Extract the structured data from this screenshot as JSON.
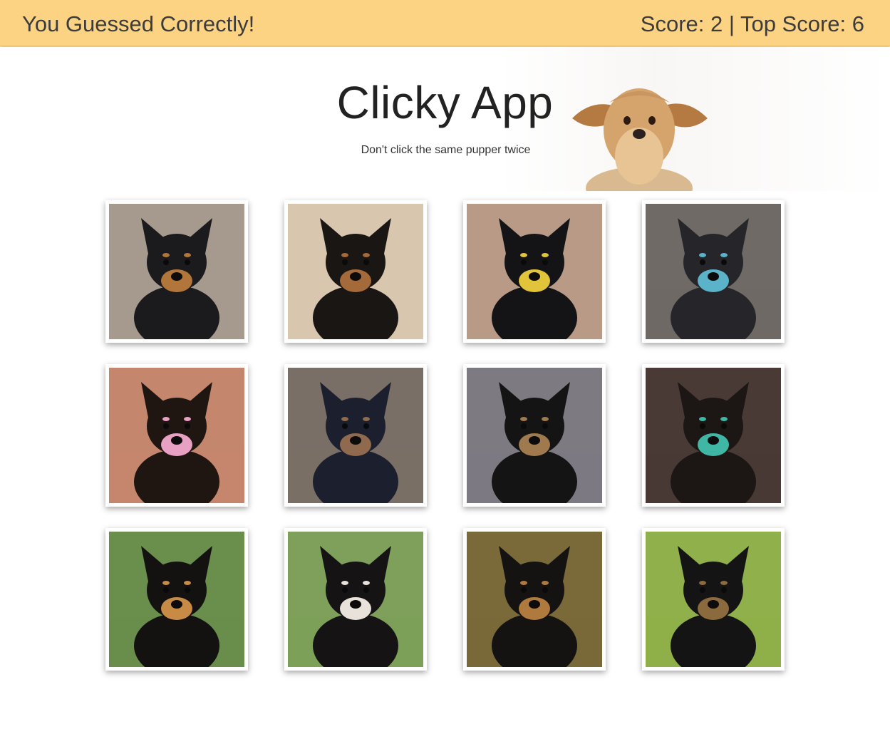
{
  "navbar": {
    "status": "You Guessed Correctly!",
    "score_text": "Score: 2 | Top Score: 6"
  },
  "hero": {
    "title": "Clicky App",
    "subtitle": "Don't click the same pupper twice"
  },
  "cards": [
    {
      "name": "dog-tan-on-tile",
      "bg": "#a69a8e",
      "coat": "#1b1a1c",
      "accent": "#b3763a"
    },
    {
      "name": "dog-puppy-sitting",
      "bg": "#d8c7ae",
      "coat": "#1a1614",
      "accent": "#a46a3a"
    },
    {
      "name": "dog-with-toy",
      "bg": "#b89a86",
      "coat": "#141416",
      "accent": "#e2c43a"
    },
    {
      "name": "dog-with-rope",
      "bg": "#6f6a66",
      "coat": "#25252a",
      "accent": "#5bb3c9"
    },
    {
      "name": "dog-bowtie",
      "bg": "#c5866e",
      "coat": "#1f1511",
      "accent": "#e8a1c3"
    },
    {
      "name": "black-bear",
      "bg": "#7a6f66",
      "coat": "#1b1f2e",
      "accent": "#8f6a4e"
    },
    {
      "name": "dogs-sleeping",
      "bg": "#7e7a82",
      "coat": "#141414",
      "accent": "#9e7a4e"
    },
    {
      "name": "dog-party-hat",
      "bg": "#4a3a36",
      "coat": "#1c1614",
      "accent": "#3fb7a4"
    },
    {
      "name": "puppy-on-grass",
      "bg": "#6a8e4c",
      "coat": "#141211",
      "accent": "#c88b46"
    },
    {
      "name": "dog-smiling",
      "bg": "#7ea05a",
      "coat": "#151314",
      "accent": "#e8e2da"
    },
    {
      "name": "puppy-closeup",
      "bg": "#7a6a3a",
      "coat": "#151312",
      "accent": "#b07a3e"
    },
    {
      "name": "puppy-in-field",
      "bg": "#8fb04a",
      "coat": "#141414",
      "accent": "#8b6a3e"
    }
  ]
}
